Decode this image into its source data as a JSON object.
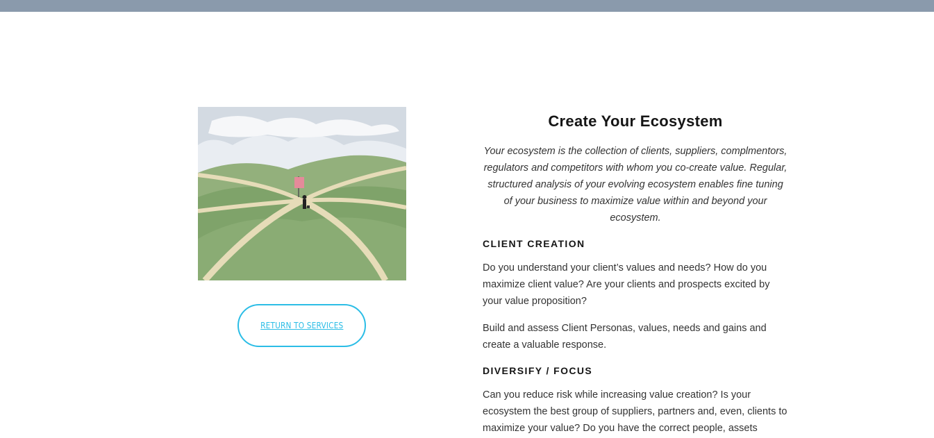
{
  "colors": {
    "top_bar": "#8a9aac",
    "accent": "#2bbde6",
    "heading": "#151515",
    "body_text": "#333333"
  },
  "illustration": {
    "icon": "landscape-crossroads-illustration"
  },
  "return_button": {
    "label": "RETURN TO SERVICES"
  },
  "content": {
    "title": "Create Your Ecosystem",
    "intro": "Your ecosystem is the collection of clients, suppliers, complmentors, regulators and competitors with whom you co-create value. Regular, structured analysis of your evolving ecosystem enables fine tuning of your business to maximize value within and beyond your ecosystem.",
    "sections": [
      {
        "heading": "CLIENT CREATION",
        "paragraphs": [
          "Do you understand your client’s values and needs? How do you maximize client value?  Are your clients and prospects excited by your value proposition?",
          "Build and assess Client Personas, values, needs and gains and create a valuable response."
        ]
      },
      {
        "heading": "DIVERSIFY / FOCUS",
        "paragraphs": [
          "Can you reduce risk while increasing value creation? Is your ecosystem the best group of suppliers, partners and, even, clients to maximize your value? Do you have the correct people, assets"
        ]
      }
    ]
  }
}
